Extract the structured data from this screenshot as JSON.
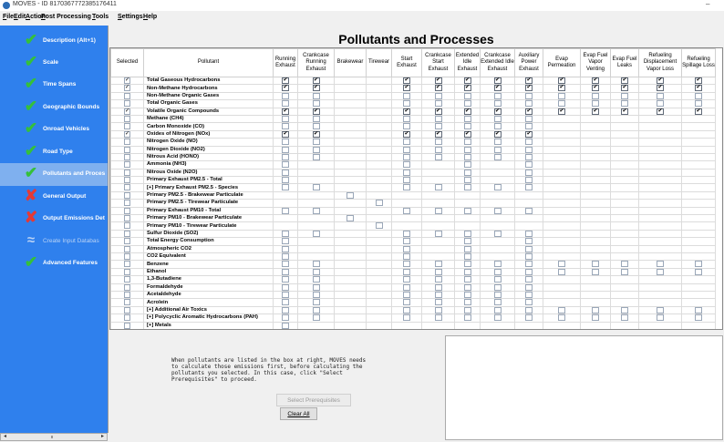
{
  "window": {
    "title": "MOVES - ID 8170367772385176411",
    "minimize": "–"
  },
  "menu": [
    {
      "label": "File",
      "key": "F",
      "rest": "ile"
    },
    {
      "label": "Edit",
      "key": "E",
      "rest": "dit"
    },
    {
      "label": "Action",
      "key": "A",
      "rest": "ction"
    },
    {
      "label": "Post Processing",
      "key": "P",
      "rest": "ost Processing"
    },
    {
      "label": "Tools",
      "key": "T",
      "rest": "ools"
    },
    {
      "label": "Settings",
      "key": "S",
      "rest": "ettings"
    },
    {
      "label": "Help",
      "key": "H",
      "rest": "elp"
    }
  ],
  "sidebar": {
    "items": [
      {
        "label": "Description (Alt+1)",
        "status": "check"
      },
      {
        "label": "Scale",
        "status": "check"
      },
      {
        "label": "Time Spans",
        "status": "check"
      },
      {
        "label": "Geographic Bounds",
        "status": "check"
      },
      {
        "label": "Onroad Vehicles",
        "status": "check"
      },
      {
        "label": "Road Type",
        "status": "check"
      },
      {
        "label": "Pollutants and Proces",
        "status": "check"
      },
      {
        "label": "General Output",
        "status": "cross"
      },
      {
        "label": "Output Emissions Det",
        "status": "cross"
      },
      {
        "label": "Create Input Databas",
        "status": "disabled"
      },
      {
        "label": "Advanced Features",
        "status": "check"
      }
    ]
  },
  "heading": "Pollutants and Processes",
  "table": {
    "selected_header": "Selected",
    "pollutant_header": "Pollutant",
    "process_headers": [
      "Running Exhaust",
      "Crankcase Running Exhaust",
      "Brakewear",
      "Tirewear",
      "Start Exhaust",
      "Crankcase Start Exhaust",
      "Extended Idle Exhaust",
      "Crankcase Extended Idle Exhaust",
      "Auxiliary Power Exhaust",
      "Evap Permeation",
      "Evap Fuel Vapor Venting",
      "Evap Fuel Leaks",
      "Refueling Displacement Vapor Loss",
      "Refueling Spillage Loss"
    ],
    "rows": [
      {
        "name": "Total Gaseous Hydrocarbons",
        "selected": true,
        "cells": "CC..CCCCCCCCCC"
      },
      {
        "name": "Non-Methane Hydrocarbons",
        "selected": true,
        "cells": "CC..CCCCCCCCCC"
      },
      {
        "name": "Non-Methane Organic Gases",
        "selected": false,
        "cells": "EE..EEEEEEEEEE"
      },
      {
        "name": "Total Organic Gases",
        "selected": false,
        "cells": "EE..EEEEEEEEEE"
      },
      {
        "name": "Volatile Organic Compounds",
        "selected": true,
        "cells": "CC..CCCCCCCCCC"
      },
      {
        "name": "Methane (CH4)",
        "selected": false,
        "cells": "EE..EEEEE....."
      },
      {
        "name": "Carbon Monoxide (CO)",
        "selected": false,
        "cells": "EE..EEEEE....."
      },
      {
        "name": "Oxides of Nitrogen (NOx)",
        "selected": true,
        "cells": "CC..CCCCC....."
      },
      {
        "name": "Nitrogen Oxide (NO)",
        "selected": false,
        "cells": "EE..EEEEE....."
      },
      {
        "name": "Nitrogen Dioxide (NO2)",
        "selected": false,
        "cells": "EE..EEEEE....."
      },
      {
        "name": "Nitrous Acid (HONO)",
        "selected": false,
        "cells": "EE..EEEEE....."
      },
      {
        "name": "Ammonia (NH3)",
        "selected": false,
        "cells": "E...E.E.E....."
      },
      {
        "name": "Nitrous Oxide (N2O)",
        "selected": false,
        "cells": "E...E.E.E....."
      },
      {
        "name": "Primary Exhaust PM2.5 - Total",
        "selected": false,
        "cells": "E...E.E.E....."
      },
      {
        "name": "[+] Primary Exhaust PM2.5 - Species",
        "selected": false,
        "cells": "EE..EEEEE....."
      },
      {
        "name": "Primary PM2.5 - Brakewear Particulate",
        "selected": false,
        "cells": "..E..........."
      },
      {
        "name": "Primary PM2.5 - Tirewear Particulate",
        "selected": false,
        "cells": "...E.........."
      },
      {
        "name": "Primary Exhaust PM10 - Total",
        "selected": false,
        "cells": "EE..EEEEE....."
      },
      {
        "name": "Primary PM10 - Brakewear Particulate",
        "selected": false,
        "cells": "..E..........."
      },
      {
        "name": "Primary PM10 - Tirewear Particulate",
        "selected": false,
        "cells": "...E.........."
      },
      {
        "name": "Sulfur Dioxide (SO2)",
        "selected": false,
        "cells": "EE..EEEEE....."
      },
      {
        "name": "Total Energy Consumption",
        "selected": false,
        "cells": "E...E.E.E....."
      },
      {
        "name": "Atmospheric CO2",
        "selected": false,
        "cells": "E...E.E.E....."
      },
      {
        "name": "CO2 Equivalent",
        "selected": false,
        "cells": "E...E.E.E....."
      },
      {
        "name": "Benzene",
        "selected": false,
        "cells": "EE..EEEEEEEEEE"
      },
      {
        "name": "Ethanol",
        "selected": false,
        "cells": "EE..EEEEEEEEEE"
      },
      {
        "name": "1,3-Butadiene",
        "selected": false,
        "cells": "EE..EEEEE....."
      },
      {
        "name": "Formaldehyde",
        "selected": false,
        "cells": "EE..EEEEE....."
      },
      {
        "name": "Acetaldehyde",
        "selected": false,
        "cells": "EE..EEEEE....."
      },
      {
        "name": "Acrolein",
        "selected": false,
        "cells": "EE..EEEEE....."
      },
      {
        "name": "[+] Additional Air Toxics",
        "selected": false,
        "cells": "EE..EEEEEEEEEE"
      },
      {
        "name": "[+] Polycyclic Aromatic Hydrocarbons (PAH)",
        "selected": false,
        "cells": "EE..EEEEEEEEEE"
      },
      {
        "name": "[+] Metals",
        "selected": false,
        "cells": "E............."
      }
    ]
  },
  "message": "When pollutants are listed in the box at right, MOVES needs\nto calculate those emissions first, before calculating the\npollutants you selected. In this case, click \"Select\nPrerequisites\" to proceed.",
  "buttons": {
    "select_prerequisites": "Select Prerequisites",
    "clear_all": "Clear All"
  }
}
